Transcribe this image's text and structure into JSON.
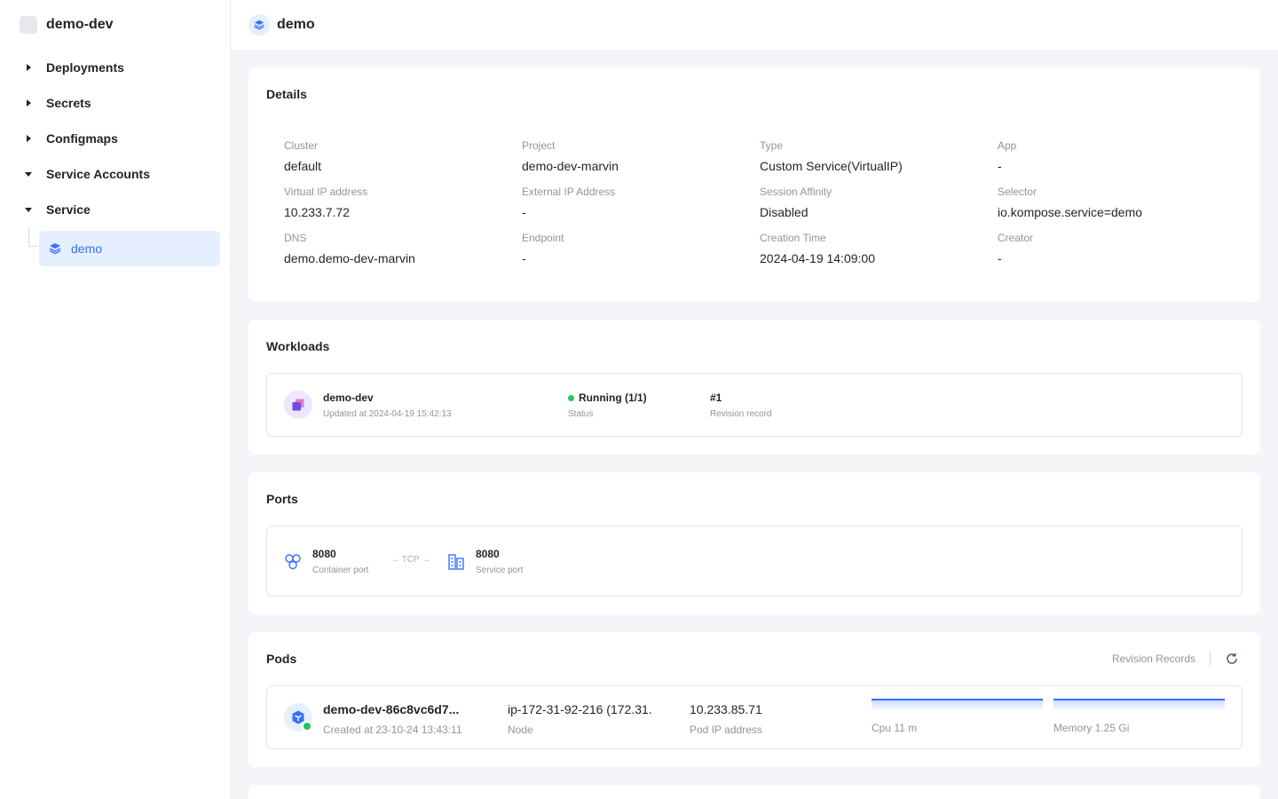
{
  "sidebar": {
    "title": "demo-dev",
    "items": [
      {
        "label": "Deployments",
        "expanded": false
      },
      {
        "label": "Secrets",
        "expanded": false
      },
      {
        "label": "Configmaps",
        "expanded": false
      },
      {
        "label": "Service Accounts",
        "expanded": true
      },
      {
        "label": "Service",
        "expanded": true
      }
    ],
    "active_sub": {
      "label": "demo"
    }
  },
  "topbar": {
    "title": "demo"
  },
  "details": {
    "title": "Details",
    "fields": [
      {
        "label": "Cluster",
        "value": "default"
      },
      {
        "label": "Project",
        "value": "demo-dev-marvin"
      },
      {
        "label": "Type",
        "value": "Custom Service(VirtualIP)"
      },
      {
        "label": "App",
        "value": "-"
      },
      {
        "label": "Virtual IP address",
        "value": "10.233.7.72"
      },
      {
        "label": "External IP Address",
        "value": "-"
      },
      {
        "label": "Session Affinity",
        "value": "Disabled"
      },
      {
        "label": "Selector",
        "value": "io.kompose.service=demo"
      },
      {
        "label": "DNS",
        "value": "demo.demo-dev-marvin"
      },
      {
        "label": "Endpoint",
        "value": "-"
      },
      {
        "label": "Creation Time",
        "value": "2024-04-19 14:09:00"
      },
      {
        "label": "Creator",
        "value": "-"
      }
    ]
  },
  "workloads": {
    "title": "Workloads",
    "item": {
      "name": "demo-dev",
      "updated": "Updated at 2024-04-19 15:42:13",
      "status_value": "Running (1/1)",
      "status_label": "Status",
      "revision_value": "#1",
      "revision_label": "Revision record",
      "status_color": "#22c55e"
    }
  },
  "ports": {
    "title": "Ports",
    "container_port": "8080",
    "container_label": "Container port",
    "protocol": "→ TCP →",
    "service_port": "8080",
    "service_label": "Service port"
  },
  "pods": {
    "title": "Pods",
    "revision_records": "Revision Records",
    "item": {
      "name": "demo-dev-86c8vc6d7...",
      "created": "Created at 23-10-24 13:43:11",
      "node_value": "ip-172-31-92-216 (172.31.",
      "node_label": "Node",
      "ip_value": "10.233.85.71",
      "ip_label": "Pod IP address",
      "cpu_label": "Cpu 11 m",
      "memory_label": "Memory 1.25 Gi"
    }
  },
  "colors": {
    "accent": "#3370ff",
    "success": "#22c55e"
  }
}
